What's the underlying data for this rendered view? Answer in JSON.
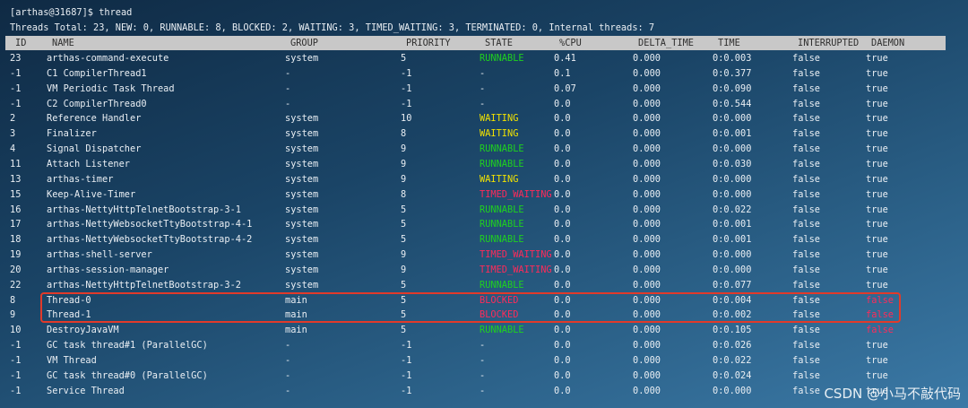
{
  "terminal": {
    "prompt": "[arthas@31687]$ thread",
    "summary": "Threads Total: 23, NEW: 0, RUNNABLE: 8, BLOCKED: 2, WAITING: 3, TIMED_WAITING: 3, TERMINATED: 0, Internal threads: 7"
  },
  "colors": {
    "RUNNABLE": "#1fd11f",
    "WAITING": "#f2e200",
    "TIMED_WAITING": "#ff2a5a",
    "BLOCKED": "#ff2a5a",
    "daemon_false_highlight": "#ff2a5a",
    "default_text": "#e9eef3",
    "highlight_border": "#e23a2a"
  },
  "table": {
    "headers": {
      "id": "ID",
      "name": "NAME",
      "group": "GROUP",
      "priority": "PRIORITY",
      "state": "STATE",
      "cpu": "%CPU",
      "delta_time": "DELTA_TIME",
      "time": "TIME",
      "interrupted": "INTERRUPTED",
      "daemon": "DAEMON"
    },
    "rows": [
      {
        "id": "23",
        "name": "arthas-command-execute",
        "group": "system",
        "priority": "5",
        "state": "RUNNABLE",
        "cpu": "0.41",
        "delta_time": "0.000",
        "time": "0:0.003",
        "interrupted": "false",
        "daemon": "true"
      },
      {
        "id": "-1",
        "name": "C1 CompilerThread1",
        "group": "-",
        "priority": "-1",
        "state": "-",
        "cpu": "0.1",
        "delta_time": "0.000",
        "time": "0:0.377",
        "interrupted": "false",
        "daemon": "true"
      },
      {
        "id": "-1",
        "name": "VM Periodic Task Thread",
        "group": "-",
        "priority": "-1",
        "state": "-",
        "cpu": "0.07",
        "delta_time": "0.000",
        "time": "0:0.090",
        "interrupted": "false",
        "daemon": "true"
      },
      {
        "id": "-1",
        "name": "C2 CompilerThread0",
        "group": "-",
        "priority": "-1",
        "state": "-",
        "cpu": "0.0",
        "delta_time": "0.000",
        "time": "0:0.544",
        "interrupted": "false",
        "daemon": "true"
      },
      {
        "id": "2",
        "name": "Reference Handler",
        "group": "system",
        "priority": "10",
        "state": "WAITING",
        "cpu": "0.0",
        "delta_time": "0.000",
        "time": "0:0.000",
        "interrupted": "false",
        "daemon": "true"
      },
      {
        "id": "3",
        "name": "Finalizer",
        "group": "system",
        "priority": "8",
        "state": "WAITING",
        "cpu": "0.0",
        "delta_time": "0.000",
        "time": "0:0.001",
        "interrupted": "false",
        "daemon": "true"
      },
      {
        "id": "4",
        "name": "Signal Dispatcher",
        "group": "system",
        "priority": "9",
        "state": "RUNNABLE",
        "cpu": "0.0",
        "delta_time": "0.000",
        "time": "0:0.000",
        "interrupted": "false",
        "daemon": "true"
      },
      {
        "id": "11",
        "name": "Attach Listener",
        "group": "system",
        "priority": "9",
        "state": "RUNNABLE",
        "cpu": "0.0",
        "delta_time": "0.000",
        "time": "0:0.030",
        "interrupted": "false",
        "daemon": "true"
      },
      {
        "id": "13",
        "name": "arthas-timer",
        "group": "system",
        "priority": "9",
        "state": "WAITING",
        "cpu": "0.0",
        "delta_time": "0.000",
        "time": "0:0.000",
        "interrupted": "false",
        "daemon": "true"
      },
      {
        "id": "15",
        "name": "Keep-Alive-Timer",
        "group": "system",
        "priority": "8",
        "state": "TIMED_WAITING",
        "cpu": "0.0",
        "delta_time": "0.000",
        "time": "0:0.000",
        "interrupted": "false",
        "daemon": "true"
      },
      {
        "id": "16",
        "name": "arthas-NettyHttpTelnetBootstrap-3-1",
        "group": "system",
        "priority": "5",
        "state": "RUNNABLE",
        "cpu": "0.0",
        "delta_time": "0.000",
        "time": "0:0.022",
        "interrupted": "false",
        "daemon": "true"
      },
      {
        "id": "17",
        "name": "arthas-NettyWebsocketTtyBootstrap-4-1",
        "group": "system",
        "priority": "5",
        "state": "RUNNABLE",
        "cpu": "0.0",
        "delta_time": "0.000",
        "time": "0:0.001",
        "interrupted": "false",
        "daemon": "true"
      },
      {
        "id": "18",
        "name": "arthas-NettyWebsocketTtyBootstrap-4-2",
        "group": "system",
        "priority": "5",
        "state": "RUNNABLE",
        "cpu": "0.0",
        "delta_time": "0.000",
        "time": "0:0.001",
        "interrupted": "false",
        "daemon": "true"
      },
      {
        "id": "19",
        "name": "arthas-shell-server",
        "group": "system",
        "priority": "9",
        "state": "TIMED_WAITING",
        "cpu": "0.0",
        "delta_time": "0.000",
        "time": "0:0.000",
        "interrupted": "false",
        "daemon": "true"
      },
      {
        "id": "20",
        "name": "arthas-session-manager",
        "group": "system",
        "priority": "9",
        "state": "TIMED_WAITING",
        "cpu": "0.0",
        "delta_time": "0.000",
        "time": "0:0.000",
        "interrupted": "false",
        "daemon": "true"
      },
      {
        "id": "22",
        "name": "arthas-NettyHttpTelnetBootstrap-3-2",
        "group": "system",
        "priority": "5",
        "state": "RUNNABLE",
        "cpu": "0.0",
        "delta_time": "0.000",
        "time": "0:0.077",
        "interrupted": "false",
        "daemon": "true"
      },
      {
        "id": "8",
        "name": "Thread-0",
        "group": "main",
        "priority": "5",
        "state": "BLOCKED",
        "cpu": "0.0",
        "delta_time": "0.000",
        "time": "0:0.004",
        "interrupted": "false",
        "daemon": "false"
      },
      {
        "id": "9",
        "name": "Thread-1",
        "group": "main",
        "priority": "5",
        "state": "BLOCKED",
        "cpu": "0.0",
        "delta_time": "0.000",
        "time": "0:0.002",
        "interrupted": "false",
        "daemon": "false"
      },
      {
        "id": "10",
        "name": "DestroyJavaVM",
        "group": "main",
        "priority": "5",
        "state": "RUNNABLE",
        "cpu": "0.0",
        "delta_time": "0.000",
        "time": "0:0.105",
        "interrupted": "false",
        "daemon": "false"
      },
      {
        "id": "-1",
        "name": "GC task thread#1 (ParallelGC)",
        "group": "-",
        "priority": "-1",
        "state": "-",
        "cpu": "0.0",
        "delta_time": "0.000",
        "time": "0:0.026",
        "interrupted": "false",
        "daemon": "true"
      },
      {
        "id": "-1",
        "name": "VM Thread",
        "group": "-",
        "priority": "-1",
        "state": "-",
        "cpu": "0.0",
        "delta_time": "0.000",
        "time": "0:0.022",
        "interrupted": "false",
        "daemon": "true"
      },
      {
        "id": "-1",
        "name": "GC task thread#0 (ParallelGC)",
        "group": "-",
        "priority": "-1",
        "state": "-",
        "cpu": "0.0",
        "delta_time": "0.000",
        "time": "0:0.024",
        "interrupted": "false",
        "daemon": "true"
      },
      {
        "id": "-1",
        "name": "Service Thread",
        "group": "-",
        "priority": "-1",
        "state": "-",
        "cpu": "0.0",
        "delta_time": "0.000",
        "time": "0:0.000",
        "interrupted": "false",
        "daemon": "true"
      }
    ]
  },
  "watermark": "CSDN @小马不敲代码"
}
